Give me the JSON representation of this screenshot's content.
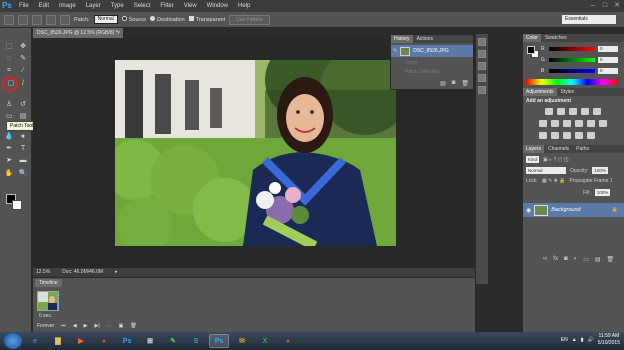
{
  "app": {
    "logo": "Ps",
    "menu": [
      "File",
      "Edit",
      "Image",
      "Layer",
      "Type",
      "Select",
      "Filter",
      "View",
      "Window",
      "Help"
    ],
    "window_controls": [
      "–",
      "□",
      "✕"
    ]
  },
  "options_bar": {
    "patch_label": "Patch:",
    "patch_value": "Normal",
    "source_label": "Source",
    "destination_label": "Destination",
    "transparent_label": "Transparent",
    "use_pattern_label": "Use Pattern",
    "workspace": "Essentials"
  },
  "tools": {
    "tooltip": "Patch Tool (J)",
    "icons": [
      "move-icon",
      "marquee-icon",
      "lasso-icon",
      "quick-select-icon",
      "crop-icon",
      "eyedropper-icon",
      "patch-icon",
      "brush-icon",
      "clone-stamp-icon",
      "history-brush-icon",
      "eraser-icon",
      "gradient-icon",
      "blur-icon",
      "dodge-icon",
      "pen-icon",
      "type-icon",
      "path-select-icon",
      "shape-icon",
      "hand-icon",
      "zoom-icon"
    ]
  },
  "document": {
    "tab_title": "DSC_8526.JPG @ 12.5% (RGB/8) *",
    "zoom": "12.5%",
    "doc_size": "Doc: 46.0M/46.0M"
  },
  "timeline": {
    "tab": "Timeline",
    "frame_delay": "0 sec.",
    "loop": "Forever"
  },
  "history": {
    "tabs": [
      "History",
      "Actions"
    ],
    "snapshot": "DSC_8526.JPG",
    "items": [
      "Open",
      "Patch Selection"
    ]
  },
  "color_panel": {
    "tabs": [
      "Color",
      "Swatches"
    ],
    "channels": [
      {
        "label": "R",
        "value": "0"
      },
      {
        "label": "G",
        "value": "0"
      },
      {
        "label": "B",
        "value": "0"
      }
    ]
  },
  "adjustments": {
    "tabs": [
      "Adjustments",
      "Styles"
    ],
    "title": "Add an adjustment"
  },
  "layers": {
    "tabs": [
      "Layers",
      "Channels",
      "Paths"
    ],
    "kind": "Kind",
    "blend": "Normal",
    "opacity_label": "Opacity:",
    "opacity": "100%",
    "lock_label": "Lock:",
    "propagate": "Propagate Frame 1",
    "fill_label": "Fill:",
    "fill": "100%",
    "background_layer": "Background"
  },
  "taskbar": {
    "apps": [
      "IE",
      "Folder",
      "Player",
      "Chrome",
      "Ps",
      "Win",
      "Pen",
      "Skype",
      "Ps",
      "Mail",
      "Excel",
      "Chrome"
    ],
    "language": "EN",
    "time": "11:59 AM",
    "date": "5/10/2015"
  }
}
